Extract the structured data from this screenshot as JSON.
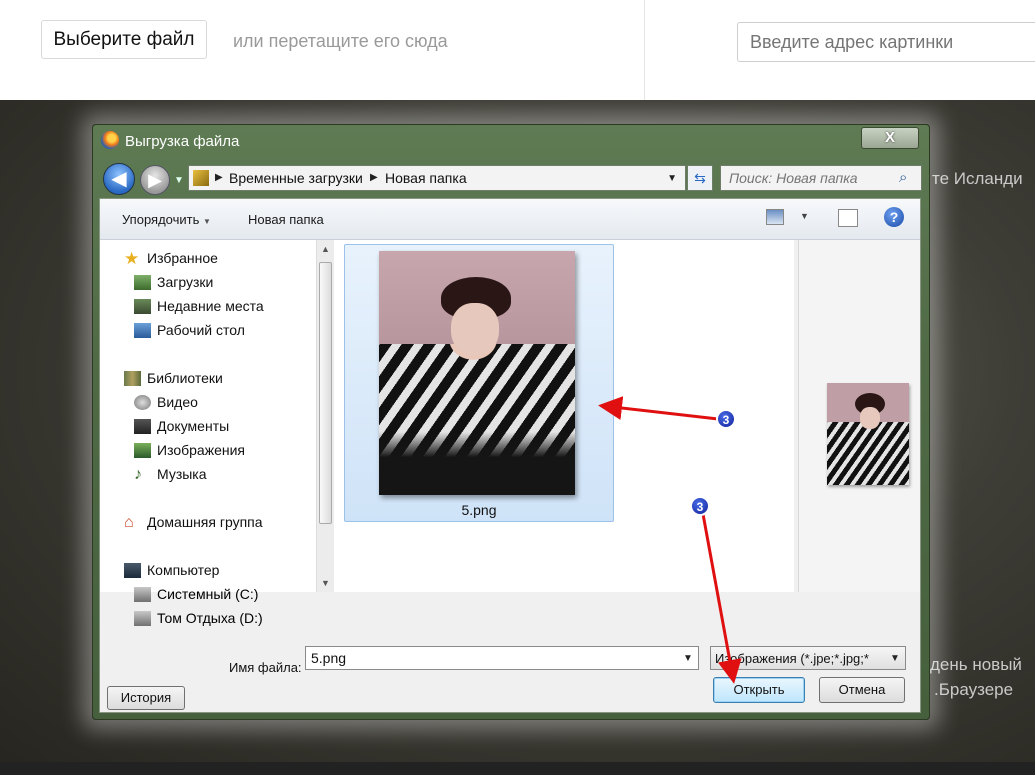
{
  "page": {
    "choose_file_label": "Выберите файл",
    "drag_hint": "или перетащите его сюда",
    "url_placeholder": "Введите адрес картинки",
    "bg_texts": [
      "те Исланди",
      "день новый",
      ".Браузере"
    ]
  },
  "dialog": {
    "title": "Выгрузка файла",
    "close_label": "X",
    "breadcrumb": [
      "Временные загрузки",
      "Новая папка"
    ],
    "search_placeholder": "Поиск: Новая папка",
    "toolbar": {
      "organize_label": "Упорядочить",
      "new_folder_label": "Новая папка",
      "help_label": "?"
    },
    "nav": [
      {
        "label": "Избранное"
      },
      {
        "label": "Загрузки"
      },
      {
        "label": "Недавние места"
      },
      {
        "label": "Рабочий стол"
      },
      {
        "label": "Библиотеки"
      },
      {
        "label": "Видео"
      },
      {
        "label": "Документы"
      },
      {
        "label": "Изображения"
      },
      {
        "label": "Музыка"
      },
      {
        "label": "Домашняя группа"
      },
      {
        "label": "Компьютер"
      },
      {
        "label": "Системный (C:)"
      },
      {
        "label": "Том Отдыха (D:)"
      }
    ],
    "file": {
      "name": "5.png"
    },
    "filename_label": "Имя файла:",
    "filename_value": "5.png",
    "filetype_value": "Изображения (*.jpe;*.jpg;*",
    "open_label": "Открыть",
    "cancel_label": "Отмена",
    "history_label": "История"
  },
  "annotations": {
    "badge_1": "3",
    "badge_2": "3",
    "arrow_color": "#e01010"
  },
  "colors": {
    "dialog_frame": "#4f6a45",
    "open_button": "#bee6fd",
    "badge": "#10209a"
  }
}
